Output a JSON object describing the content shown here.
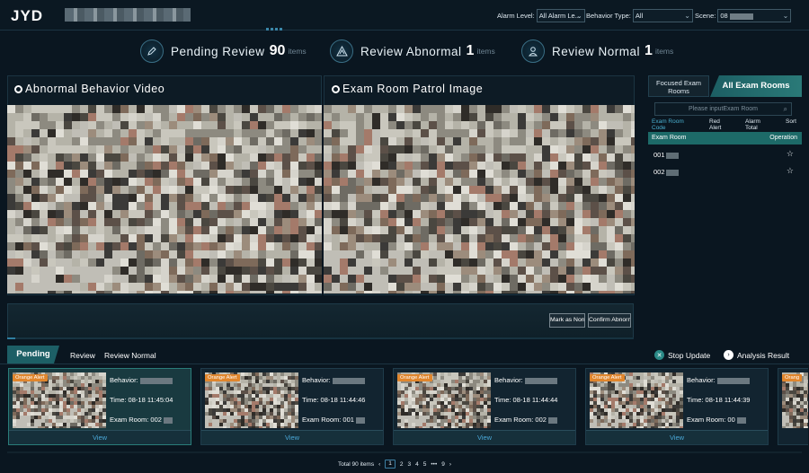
{
  "header": {
    "logo": "JYD",
    "filters": {
      "alarm_level_label": "Alarm Level:",
      "alarm_level_value": "All Alarm Le...",
      "behavior_type_label": "Behavior Type:",
      "behavior_type_value": "All",
      "scene_label": "Scene:",
      "scene_value": "08"
    }
  },
  "stats": [
    {
      "label": "Pending Review",
      "count": "90",
      "unit": "items"
    },
    {
      "label": "Review Abnormal",
      "count": "1",
      "unit": "items"
    },
    {
      "label": "Review Normal",
      "count": "1",
      "unit": "items"
    }
  ],
  "panels": {
    "video_title": "Abnormal Behavior Video",
    "patrol_title": "Exam Room Patrol Image"
  },
  "controls": {
    "mark_normal": "Mark as Normal",
    "confirm_abnormal": "Confirm Abnormal"
  },
  "room_panel": {
    "tab_focused": "Focused Exam Rooms",
    "tab_all": "All Exam Rooms",
    "search_placeholder": "Please inputExam Room",
    "columns": [
      "Exam Room Code",
      "Red Alert",
      "Alarm Total",
      "Sort"
    ],
    "row_header_left": "Exam Room",
    "row_header_right": "Operation",
    "rooms": [
      {
        "code": "001"
      },
      {
        "code": "002"
      }
    ]
  },
  "bottom": {
    "tabs": [
      "Pending",
      "Review",
      "Review Normal"
    ],
    "stop_update": "Stop Update",
    "analysis_result": "Analysis Result",
    "alerts": [
      {
        "badge": "Orange Alert",
        "behavior_label": "Behavior:",
        "time": "Time: 08-18 11:45:04",
        "room": "Exam Room: 002",
        "view": "View"
      },
      {
        "badge": "Orange Alert",
        "behavior_label": "Behavior:",
        "time": "Time: 08-18 11:44:46",
        "room": "Exam Room: 001",
        "view": "View"
      },
      {
        "badge": "Orange Alert",
        "behavior_label": "Behavior:",
        "time": "Time: 08-18 11:44:44",
        "room": "Exam Room: 002",
        "view": "View"
      },
      {
        "badge": "Orange Alert",
        "behavior_label": "Behavior:",
        "time": "Time: 08-18 11:44:39",
        "room": "Exam Room: 00",
        "view": "View"
      },
      {
        "badge": "Orang"
      }
    ],
    "pagination": {
      "total": "Total 90 items",
      "prev": "‹",
      "pages": [
        "1",
        "2",
        "3",
        "4",
        "5",
        "•••",
        "9"
      ],
      "next": "›"
    }
  },
  "colors": {
    "background": "#0a1620",
    "accent_teal": "#1d6a68",
    "orange_alert": "#e0862d",
    "view_link": "#4aa8d8"
  },
  "icons": [
    "pen-icon",
    "hazard-icon",
    "person-icon",
    "star-icon",
    "search-icon",
    "close-circle-icon",
    "chevron-circle-icon",
    "caret-down-icon"
  ]
}
